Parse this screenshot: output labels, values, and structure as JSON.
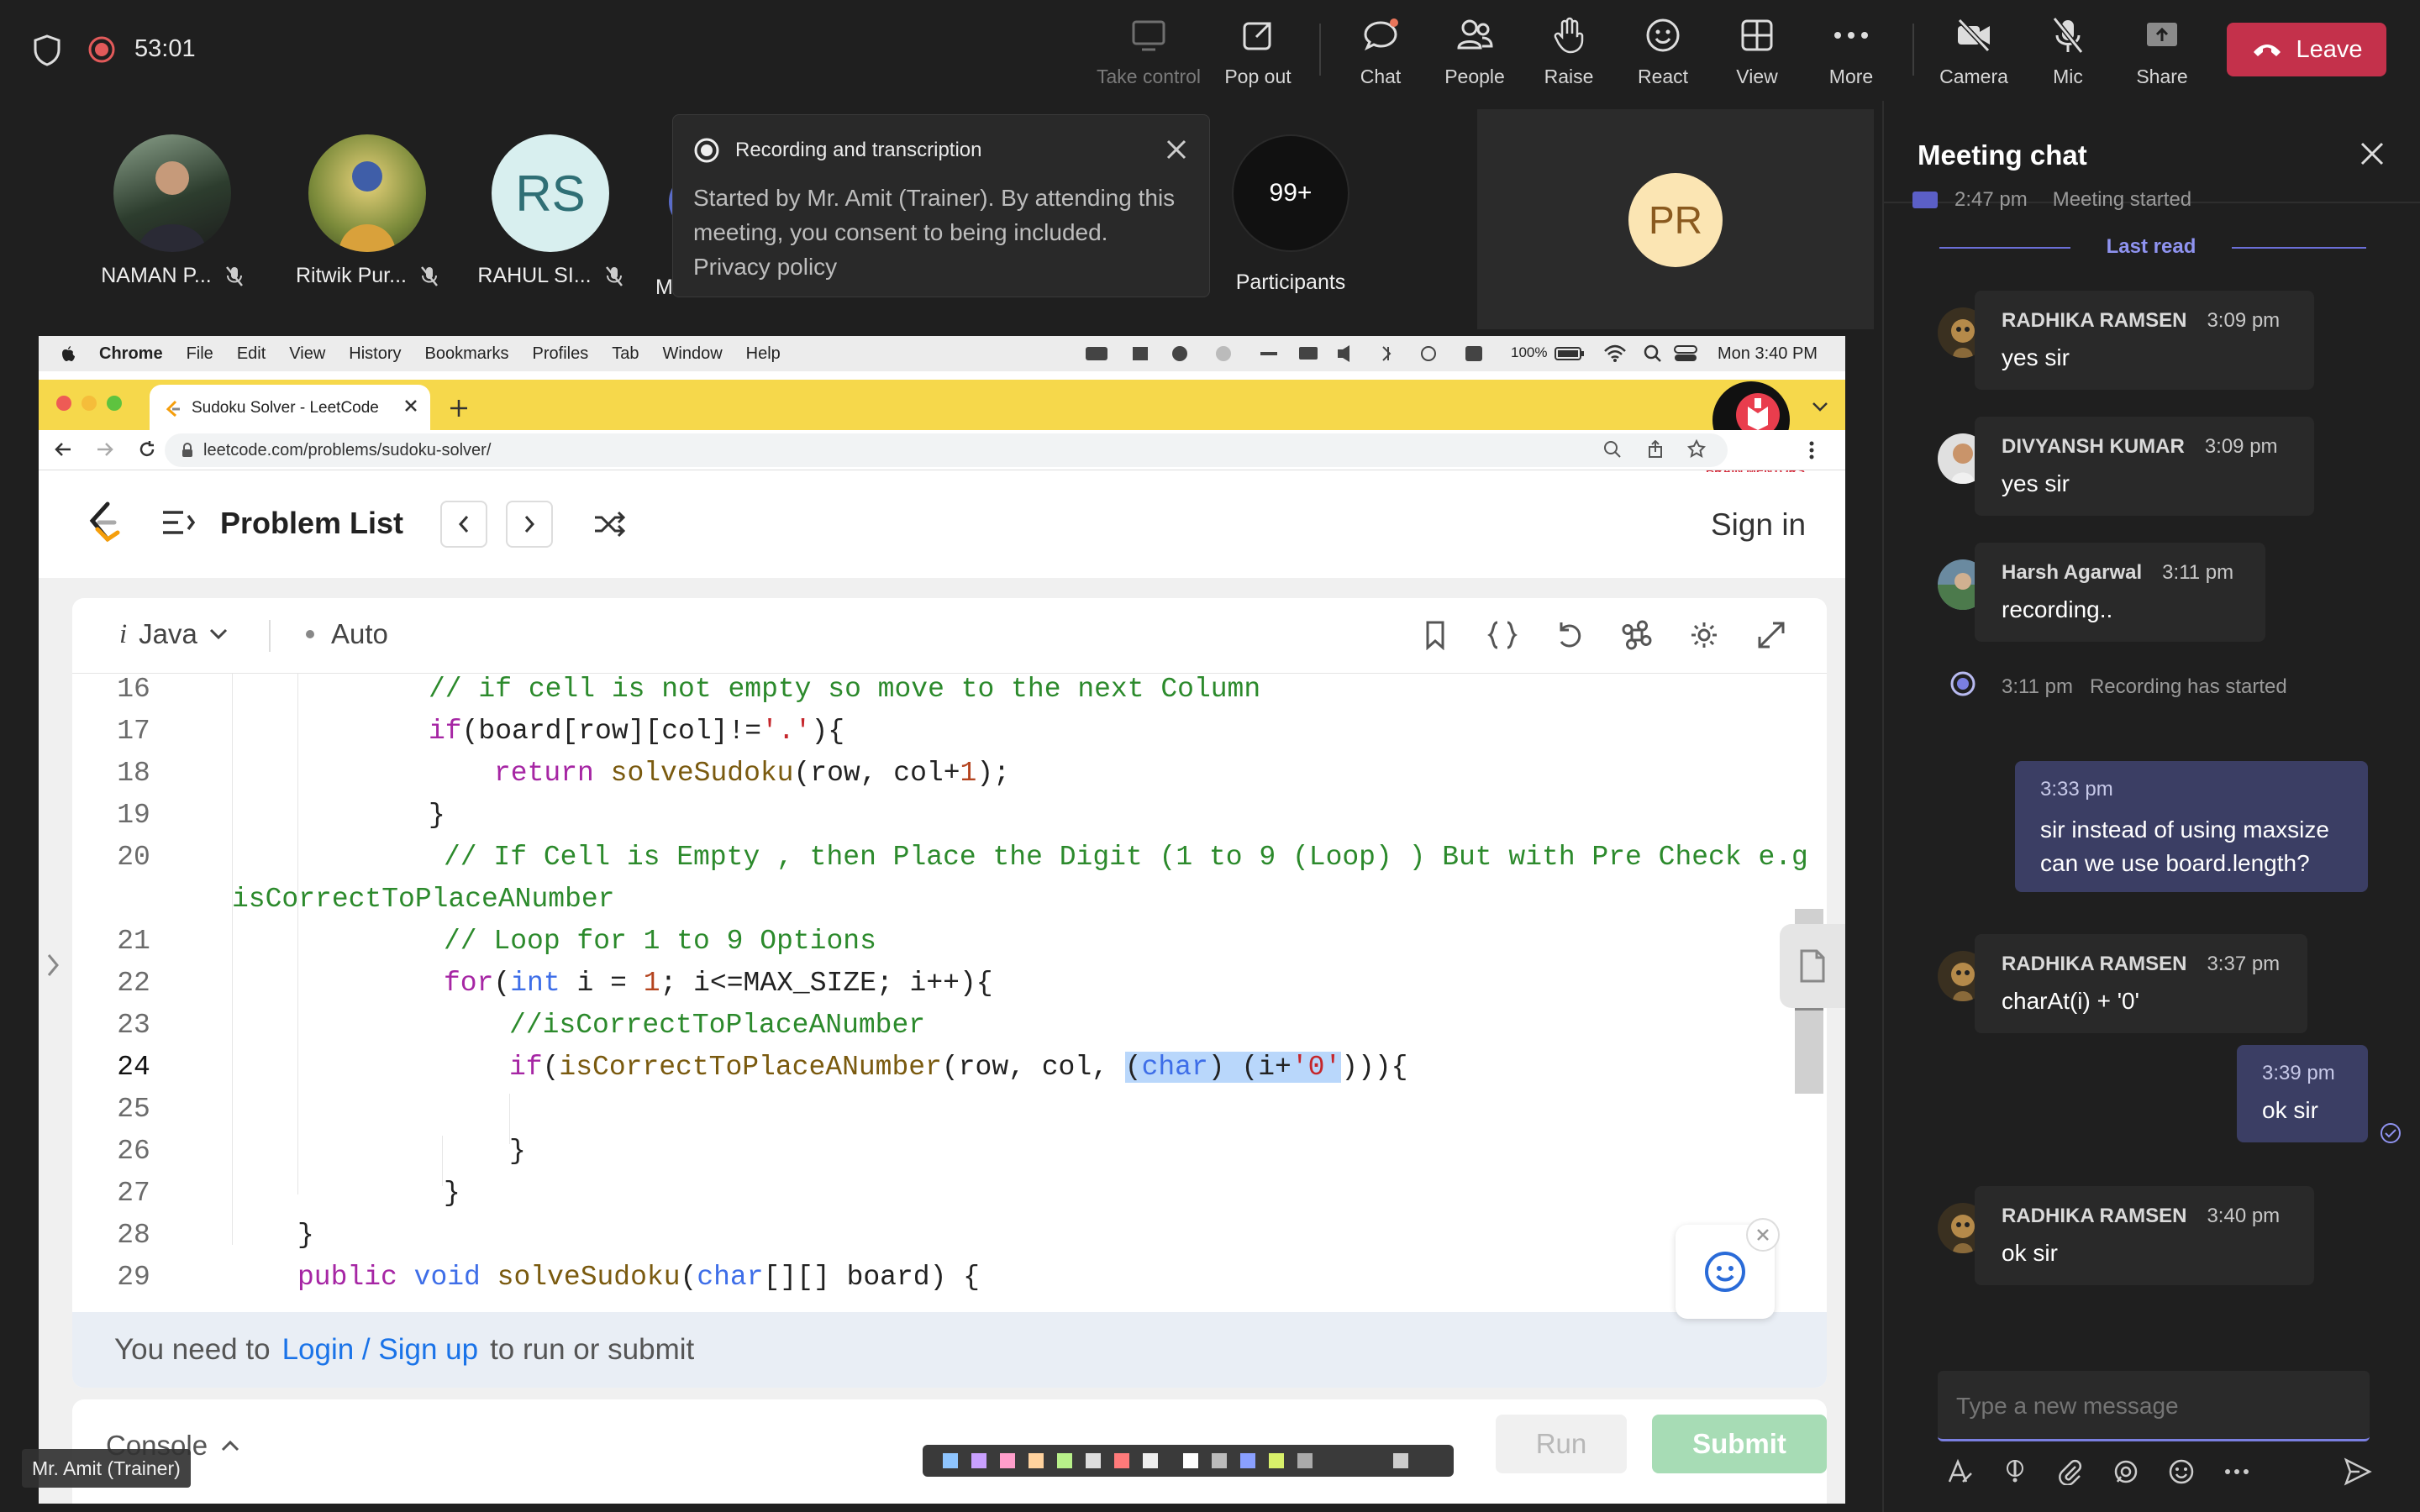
{
  "meeting": {
    "timer": "53:01",
    "toolbar": {
      "take_control": "Take control",
      "pop_out": "Pop out",
      "chat": "Chat",
      "people": "People",
      "raise": "Raise",
      "react": "React",
      "view": "View",
      "more": "More",
      "camera": "Camera",
      "mic": "Mic",
      "share": "Share",
      "leave": "Leave"
    },
    "participants": [
      {
        "name": "NAMAN P..."
      },
      {
        "name": "Ritwik Pur..."
      },
      {
        "name": "RAHUL SI...",
        "initials": "RS"
      },
      {
        "name": "M"
      }
    ],
    "participants_count": {
      "value": "99+",
      "label": "Participants"
    },
    "self_tile_initials": "PR",
    "recording_banner": {
      "title": "Recording and transcription",
      "body": "Started by Mr. Amit (Trainer). By attending this meeting, you consent to being included. Privacy policy"
    },
    "presenter_label": "Mr. Amit (Trainer)"
  },
  "shared_screen": {
    "mac_menu": [
      "Chrome",
      "File",
      "Edit",
      "View",
      "History",
      "Bookmarks",
      "Profiles",
      "Tab",
      "Window",
      "Help"
    ],
    "battery": "100%",
    "clock": "Mon 3:40 PM",
    "tab_title": "Sudoku Solver - LeetCode",
    "url": "leetcode.com/problems/sudoku-solver/",
    "watermark": "BRAIN MENTORS",
    "leetcode": {
      "problem_list": "Problem List",
      "sign_in": "Sign in",
      "language": "Java",
      "mode": "Auto",
      "login_prompt_pre": "You need to",
      "login_link": "Login / Sign up",
      "login_prompt_post": "to run or submit",
      "console": "Console",
      "run": "Run",
      "submit": "Submit"
    },
    "line_numbers": [
      "16",
      "17",
      "18",
      "19",
      "20",
      "21",
      "22",
      "23",
      "24",
      "25",
      "26",
      "27",
      "28",
      "29"
    ],
    "code": {
      "l16": "// if cell is not empty so move to the next Column",
      "l17a": "if",
      "l17b": "(board[row][col]!=",
      "l17c": "'.'",
      "l17d": "){",
      "l18a": "return",
      "l18b": "solveSudoku",
      "l18c": "(row, col+",
      "l18d": "1",
      "l18e": ");",
      "l19": "}",
      "l20": "// If Cell is Empty , then Place the Digit (1 to 9 (Loop) ) But with Pre Check e.g",
      "l20b": "isCorrectToPlaceANumber",
      "l21": "// Loop for 1 to 9 Options",
      "l22a": "for",
      "l22b": "(",
      "l22c": "int",
      "l22d": " i = ",
      "l22e": "1",
      "l22f": "; i<=MAX_SIZE; i++){",
      "l23": "//isCorrectToPlaceANumber",
      "l24a": "if",
      "l24b": "isCorrectToPlaceANumber",
      "l24c": "(row, col, ",
      "l24d": "(",
      "l24e": "char",
      "l24f": ") (i+",
      "l24g": "'0'",
      "l24h": "))){",
      "l26": "}",
      "l27": "}",
      "l28": "}",
      "l29a": "public",
      "l29b": "void",
      "l29c": "solveSudoku",
      "l29d": "(",
      "l29e": "char",
      "l29f": "[][] board) {"
    }
  },
  "chat": {
    "title": "Meeting chat",
    "system_top": {
      "time": "2:47 pm",
      "text": "Meeting started"
    },
    "last_read": "Last read",
    "messages": [
      {
        "author": "RADHIKA RAMSEN",
        "time": "3:09 pm",
        "text": "yes sir"
      },
      {
        "author": "DIVYANSH KUMAR",
        "time": "3:09 pm",
        "text": "yes sir"
      },
      {
        "author": "Harsh Agarwal",
        "time": "3:11 pm",
        "text": "recording.."
      }
    ],
    "recording_event": {
      "time": "3:11 pm",
      "text": "Recording has started"
    },
    "mine_1": {
      "time": "3:33 pm",
      "text": "sir instead of using maxsize can we use board.length?"
    },
    "radhika_2": {
      "author": "RADHIKA RAMSEN",
      "time": "3:37 pm",
      "text": "charAt(i) + '0'"
    },
    "mine_2": {
      "time": "3:39 pm",
      "text": "ok sir"
    },
    "radhika_3": {
      "author": "RADHIKA RAMSEN",
      "time": "3:40 pm",
      "text": "ok sir"
    },
    "compose_placeholder": "Type a new message"
  }
}
